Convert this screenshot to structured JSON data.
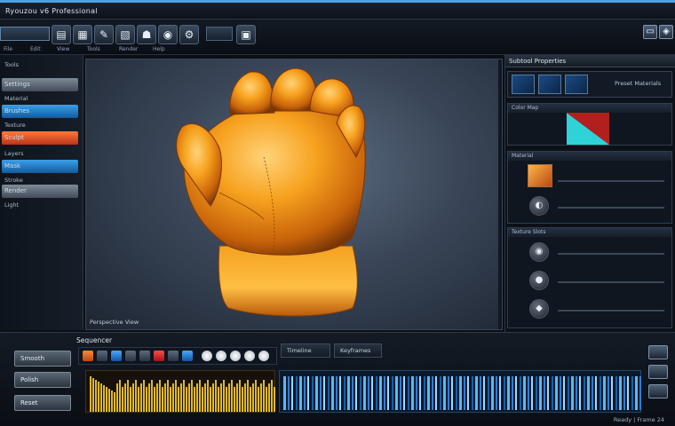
{
  "window": {
    "title": "Ryouzou v6 Professional",
    "accent_color": "#4aa3e0"
  },
  "toolbar": {
    "buttons": [
      {
        "icon": "file-icon",
        "glyph": "▤"
      },
      {
        "icon": "open-icon",
        "glyph": "▦"
      },
      {
        "icon": "brush-icon",
        "glyph": "✎"
      },
      {
        "icon": "layers-icon",
        "glyph": "▧"
      },
      {
        "icon": "sculpt-icon",
        "glyph": "☗"
      },
      {
        "icon": "camera-icon",
        "glyph": "◉"
      },
      {
        "icon": "settings-icon",
        "glyph": "⚙"
      },
      {
        "icon": "render-icon",
        "glyph": "▣"
      }
    ],
    "sub_labels": [
      "File",
      "Edit",
      "View",
      "Tools",
      "Render",
      "Help"
    ],
    "right_icons": [
      {
        "icon": "monitor-icon",
        "glyph": "▭"
      },
      {
        "icon": "shield-icon",
        "glyph": "◈"
      }
    ]
  },
  "left_panel": {
    "rows": [
      {
        "label": "Tools",
        "style": "plain"
      },
      {
        "label": "Settings",
        "style": "grey"
      },
      {
        "label": "Material",
        "style": "plain"
      },
      {
        "label": "Brushes",
        "style": "blue"
      },
      {
        "label": "Texture",
        "style": "plain"
      },
      {
        "label": "Sculpt",
        "style": "orange"
      },
      {
        "label": "Layers",
        "style": "plain"
      },
      {
        "label": "Mask",
        "style": "blue"
      },
      {
        "label": "Stroke",
        "style": "plain"
      },
      {
        "label": "Render",
        "style": "grey"
      },
      {
        "label": "Light",
        "style": "plain"
      }
    ]
  },
  "viewport": {
    "label": "Perspective View"
  },
  "right_panel": {
    "header": "Subtool Properties",
    "thumbs_caption": "Preset Materials",
    "section1": "Color Map",
    "section2": "Material",
    "section3": "Texture Slots"
  },
  "bottom": {
    "title": "Sequencer",
    "buttons": [
      "Smooth",
      "Polish",
      "Reset"
    ],
    "tabs": [
      "Timeline",
      "Keyframes"
    ],
    "status": "Ready  |  Frame 24"
  }
}
